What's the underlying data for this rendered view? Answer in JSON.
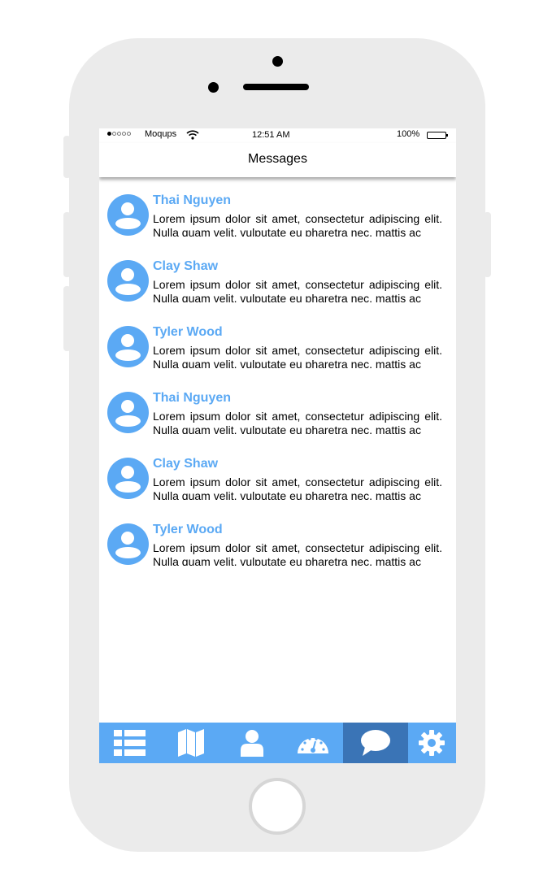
{
  "status_bar": {
    "carrier": "Moqups",
    "time": "12:51 AM",
    "battery": "100%",
    "signal_bars_filled": 1,
    "signal_bars_total": 5
  },
  "header": {
    "title": "Messages"
  },
  "messages": [
    {
      "name": "Thai Nguyen",
      "text": "Lorem ipsum dolor sit amet, consectetur adipiscing elit. Nulla quam velit, vulputate eu pharetra nec, mattis ac"
    },
    {
      "name": "Clay Shaw",
      "text": "Lorem ipsum dolor sit amet, consectetur adipiscing elit. Nulla quam velit, vulputate eu pharetra nec, mattis ac"
    },
    {
      "name": "Tyler Wood",
      "text": "Lorem ipsum dolor sit amet, consectetur adipiscing elit. Nulla quam velit, vulputate eu pharetra nec, mattis ac"
    },
    {
      "name": "Thai Nguyen",
      "text": "Lorem ipsum dolor sit amet, consectetur adipiscing elit. Nulla quam velit, vulputate eu pharetra nec, mattis ac"
    },
    {
      "name": "Clay Shaw",
      "text": "Lorem ipsum dolor sit amet, consectetur adipiscing elit. Nulla quam velit, vulputate eu pharetra nec, mattis ac"
    },
    {
      "name": "Tyler Wood",
      "text": "Lorem ipsum dolor sit amet, consectetur adipiscing elit. Nulla quam velit, vulputate eu pharetra nec, mattis ac"
    }
  ],
  "tabs": [
    {
      "icon": "list-icon"
    },
    {
      "icon": "map-icon"
    },
    {
      "icon": "user-icon"
    },
    {
      "icon": "dashboard-icon"
    },
    {
      "icon": "chat-icon",
      "active": true
    },
    {
      "icon": "settings-icon"
    }
  ],
  "colors": {
    "accent": "#5ba9f4",
    "tab_active": "#3a74b6",
    "device_body": "#ebebeb"
  }
}
